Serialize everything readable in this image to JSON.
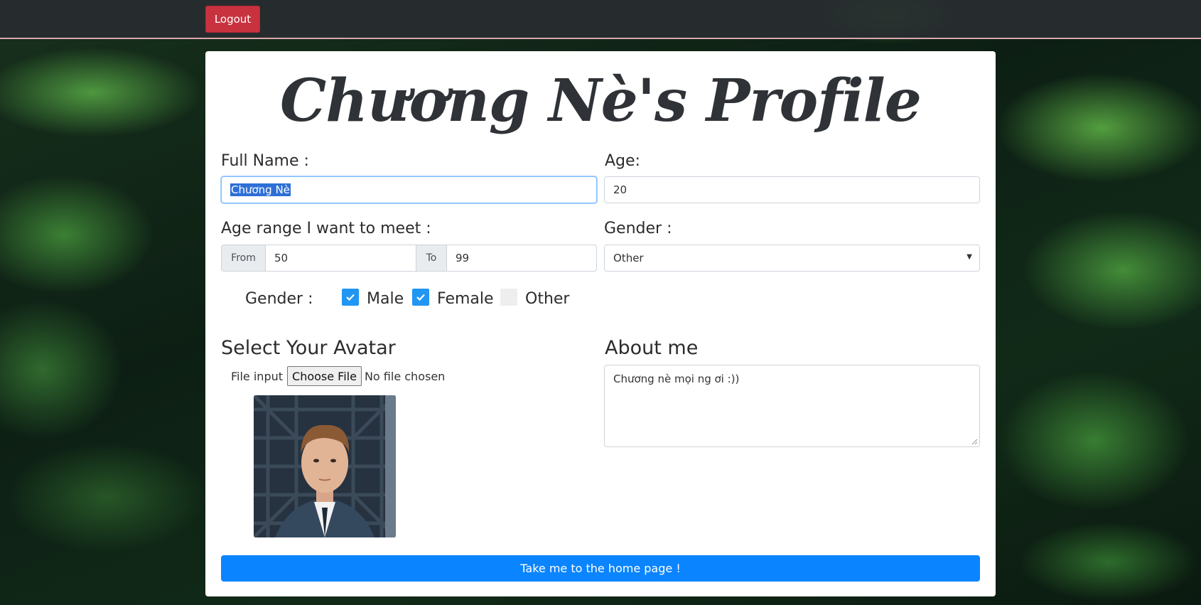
{
  "navbar": {
    "logout_label": "Logout"
  },
  "profile": {
    "title": "Chương Nè's Profile",
    "full_name_label": "Full Name :",
    "full_name_value": "Chương Nè",
    "age_label": "Age:",
    "age_value": "20",
    "age_range_label": "Age range I want to meet :",
    "from_label": "From",
    "from_value": "50",
    "to_label": "To",
    "to_value": "99",
    "gender_select_label": "Gender :",
    "gender_select_value": "Other",
    "gender_pref_label": "Gender :",
    "gender_options": [
      {
        "label": "Male",
        "checked": true
      },
      {
        "label": "Female",
        "checked": true
      },
      {
        "label": "Other",
        "checked": false
      }
    ],
    "avatar_heading": "Select Your Avatar",
    "file_input_label": "File input",
    "choose_file_label": "Choose File",
    "no_file_text": "No file chosen",
    "about_heading": "About me",
    "about_value": "Chương nè mọi ng ơi :))",
    "submit_label": "Take me to the home page !"
  },
  "colors": {
    "logout": "#c8323f",
    "primary": "#0a84ff",
    "checkbox": "#2196f3"
  }
}
